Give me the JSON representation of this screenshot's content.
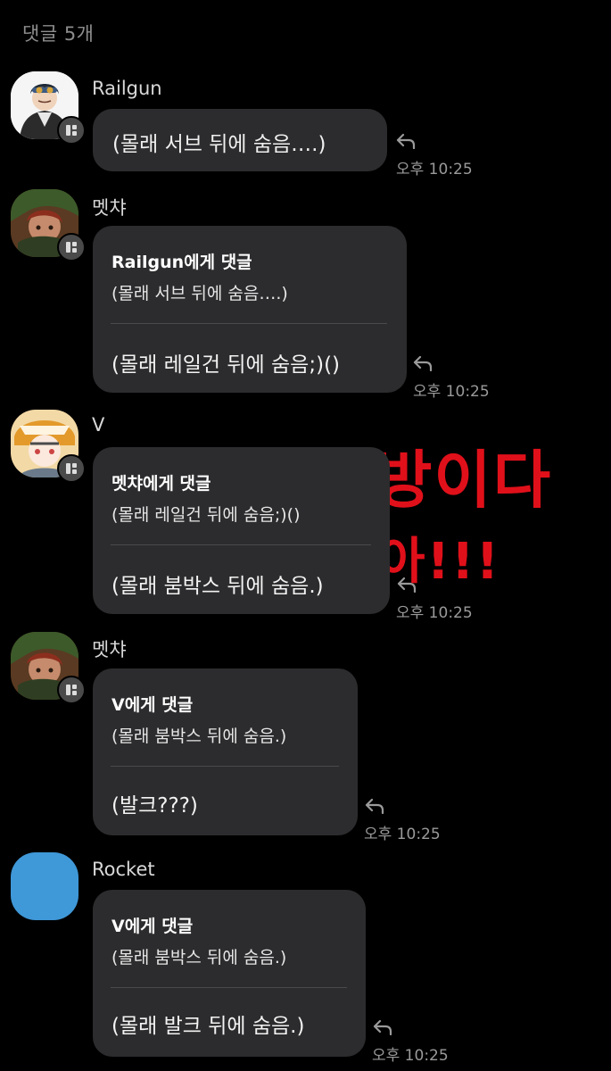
{
  "header": {
    "title": "댓글 5개"
  },
  "overlay": {
    "line1": "이건 사두방이다",
    "line2": "아!!!"
  },
  "comments": [
    {
      "user": "Railgun",
      "text": "(몰래 서브 뒤에 숨음….)",
      "time": "오후 10:25"
    },
    {
      "user": "멧챠",
      "reply_to": "Railgun에게 댓글",
      "quoted": "(몰래 서브 뒤에 숨음….)",
      "text": "(몰래 레일건 뒤에 숨음;)()",
      "time": "오후 10:25"
    },
    {
      "user": "V",
      "reply_to": "멧챠에게 댓글",
      "quoted": "(몰래 레일건 뒤에 숨음;)()",
      "text": "(몰래 붐박스 뒤에 숨음.)",
      "time": "오후 10:25"
    },
    {
      "user": "멧챠",
      "reply_to": "V에게 댓글",
      "quoted": "(몰래 붐박스 뒤에 숨음.)",
      "text": "(발크???)",
      "time": "오후 10:25"
    },
    {
      "user": "Rocket",
      "reply_to": "V에게 댓글",
      "quoted": "(몰래 붐박스 뒤에 숨음.)",
      "text": "(몰래 발크 뒤에 숨음.)",
      "time": "오후 10:25",
      "avatar_color": "#3f98d8"
    }
  ]
}
